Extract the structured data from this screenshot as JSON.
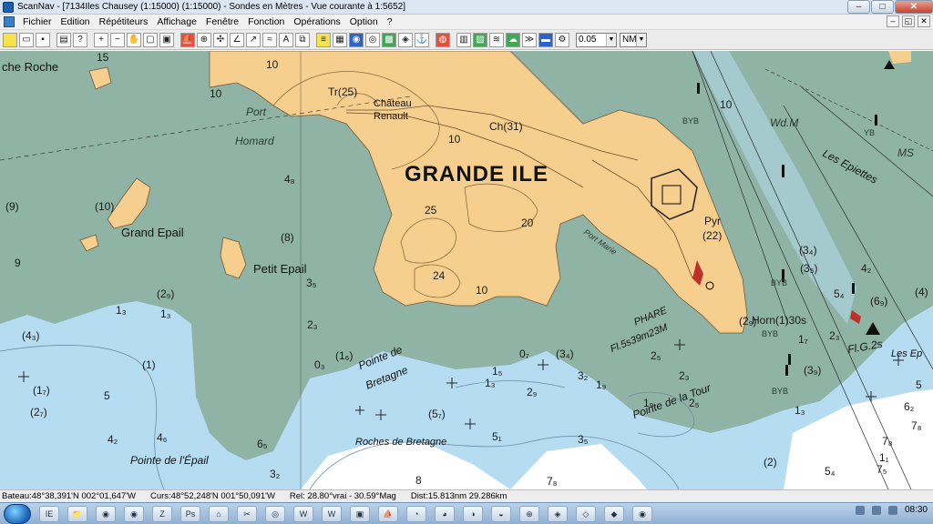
{
  "window": {
    "title": "ScanNav - [7134Iles Chausey (1:15000) (1:15000) - Sondes en  Mètres  - Vue courante à 1:5652]",
    "buttons": [
      "–",
      "□",
      "✕"
    ]
  },
  "menu": {
    "items": [
      "Fichier",
      "Edition",
      "Répétiteurs",
      "Affichage",
      "Fenêtre",
      "Fonction",
      "Opérations",
      "Option",
      "?"
    ],
    "mdi_buttons": [
      "–",
      "◱",
      "✕"
    ]
  },
  "toolbar": {
    "distance_value": "0.05",
    "unit_value": "NM"
  },
  "colors": {
    "land": "#f6cf8e",
    "foreshore": "#8fb3a4",
    "shallow": "#b6dcf2",
    "deep": "#ffffff",
    "light_sector": "#c0302a"
  },
  "map": {
    "labels": {
      "grande_ile": "GRANDE ILE",
      "grand_epail": "Grand Epail",
      "petit_epail": "Petit Epail",
      "pointe_epail": "Pointe de l'Épail",
      "pointe_bretagne_1": "Pointe de",
      "pointe_bretagne_2": "Bretagne",
      "roches_bretagne": "Roches de Bretagne",
      "pointe_tour": "Pointe de la Tour",
      "les_epiettes": "Les Epiettes",
      "port_homard_1": "Port",
      "port_homard_2": "Homard",
      "roche": "che Roche",
      "chateau_1": "Château",
      "chateau_2": "Renault",
      "tr25": "Tr(25)",
      "ch31": "Ch(31)",
      "pyr": "Pyr",
      "pyr22": "(22)",
      "phare": "PHARE",
      "phare_light": "Fl.5s39m23M",
      "horn": "Horn(1)30s",
      "fl_g": "Fl.G.2s",
      "les_ep": "Les Ep",
      "port_marie": "Port Marie",
      "byb_1": "BYB",
      "byb_2": "BYB",
      "byb_3": "BYB",
      "ybyb": "YB",
      "byb_4": "BYB",
      "wdm": "Wd.M",
      "ms": "MS"
    },
    "soundings": [
      "15",
      "10",
      "10",
      "10",
      "10",
      "25",
      "24",
      "20",
      "10",
      "4₈",
      "(8)",
      "(10)",
      "(9)",
      "9",
      "(2₉)",
      "1₃",
      "1₃",
      "(4₃)",
      "(1)",
      "5",
      "(1₇)",
      "(2₇)",
      "4₂",
      "4₆",
      "6₅",
      "2₃",
      "3₅",
      "0₃",
      "(1₆)",
      "1₅",
      "1₃",
      "2₉",
      "(3₄)",
      "0₇",
      "3₂",
      "1₉",
      "1₉",
      "2₅",
      "2₃",
      "2₅",
      "3₅",
      "(5₇)",
      "8",
      "5₁",
      "(2)",
      "7₈",
      "7₈",
      "5₄",
      "7₅",
      "3₂",
      "(3₉)",
      "1₇",
      "2₃",
      "1₃",
      "(3₄)",
      "(3₅)",
      "5₄",
      "(6₉)",
      "4₂",
      "6₂",
      "7₈",
      "5",
      "(2₉)",
      "1₁",
      "(4)"
    ]
  },
  "status": {
    "bateau": "Bateau:48°38,391'N 002°01,647'W",
    "curseur": "Curs:48°52,248'N 001°50,091'W",
    "relatif": "Rel: 28.80°vrai - 30.59°Mag",
    "distance": "Dist:15.813nm  29.286km"
  },
  "taskbar": {
    "apps": [
      "IE",
      "📁",
      "◉",
      "◉",
      "Z",
      "Ps",
      "⌂",
      "✂",
      "◎",
      "W",
      "W",
      "▣",
      "⛵",
      "◔",
      "◕",
      "◑",
      "◒",
      "⊕",
      "◈",
      "◇",
      "◆",
      "◉"
    ],
    "clock": "08:30"
  }
}
